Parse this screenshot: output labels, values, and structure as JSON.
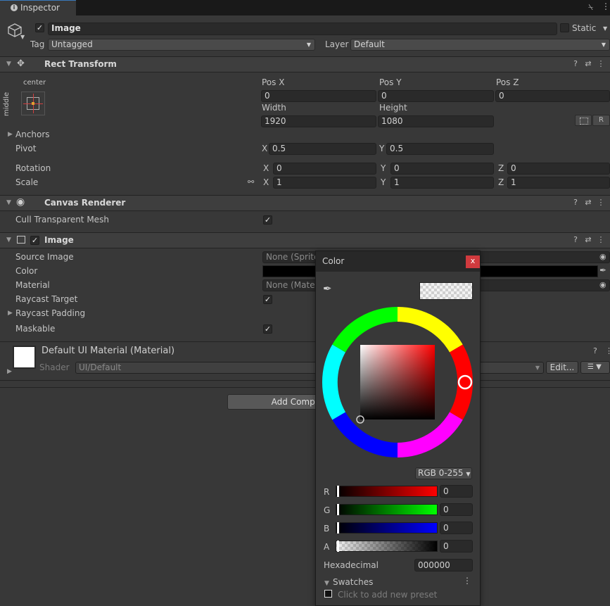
{
  "tab": {
    "icon": "info-icon",
    "label": "Inspector"
  },
  "object": {
    "name": "Image",
    "static_label": "Static",
    "tag_label": "Tag",
    "tag_value": "Untagged",
    "layer_label": "Layer",
    "layer_value": "Default"
  },
  "rect_transform": {
    "title": "Rect Transform",
    "anchor_h": "center",
    "anchor_v": "middle",
    "pos_x_label": "Pos X",
    "pos_y_label": "Pos Y",
    "pos_z_label": "Pos Z",
    "pos_x": "0",
    "pos_y": "0",
    "pos_z": "0",
    "width_label": "Width",
    "height_label": "Height",
    "width": "1920",
    "height": "1080",
    "r_button": "R",
    "anchors_label": "Anchors",
    "pivot_label": "Pivot",
    "pivot_x": "0.5",
    "pivot_y": "0.5",
    "rotation_label": "Rotation",
    "rot_x": "0",
    "rot_y": "0",
    "rot_z": "0",
    "scale_label": "Scale",
    "scale_x": "1",
    "scale_y": "1",
    "scale_z": "1",
    "x": "X",
    "y": "Y",
    "z": "Z"
  },
  "canvas_renderer": {
    "title": "Canvas Renderer",
    "cull_label": "Cull Transparent Mesh"
  },
  "image_comp": {
    "title": "Image",
    "source_image_label": "Source Image",
    "source_image_value": "None (Sprite)",
    "color_label": "Color",
    "material_label": "Material",
    "material_value": "None (Material)",
    "raycast_target_label": "Raycast Target",
    "raycast_padding_label": "Raycast Padding",
    "maskable_label": "Maskable"
  },
  "material": {
    "name": "Default UI Material (Material)",
    "shader_label": "Shader",
    "shader_value": "UI/Default",
    "edit_button": "Edit..."
  },
  "add_component": "Add Component",
  "color_picker": {
    "title": "Color",
    "close": "x",
    "mode": "RGB 0-255",
    "r_label": "R",
    "g_label": "G",
    "b_label": "B",
    "a_label": "A",
    "r": "0",
    "g": "0",
    "b": "0",
    "a": "0",
    "hex_label": "Hexadecimal",
    "hex": "000000",
    "swatches_label": "Swatches",
    "add_preset": "Click to add new preset"
  },
  "colors": {
    "accent_red": "#e0303a",
    "panel_bg": "#383838",
    "header_bg": "#3e3e3e"
  }
}
